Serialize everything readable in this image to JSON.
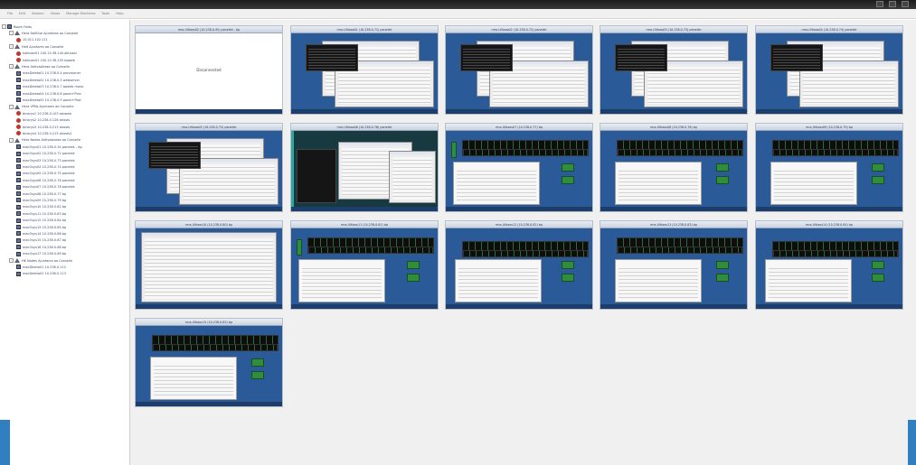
{
  "window": {
    "colors": {
      "titlebar": "#1b1b1b",
      "thumb_bg": "#2b5a99",
      "accent": "#2f7fc1",
      "tree_text": "#3f4c67"
    }
  },
  "menu": {
    "items": [
      "File",
      "Edit",
      "Session",
      "Views",
      "Manage Machines",
      "Tools",
      "Help"
    ]
  },
  "tree": {
    "items": [
      {
        "label": "Room Folds",
        "level": 0,
        "icon": "root-folder-icon",
        "expander": "-"
      },
      {
        "label": "Hera DaiBlue Ajuntams ao Conseile",
        "level": 1,
        "icon": "warning-triangle-icon",
        "expander": "-"
      },
      {
        "label": "10.011.102.111",
        "level": 2,
        "icon": "server-icon",
        "expander": ""
      },
      {
        "label": "Halt Ajuntams ao Conseile",
        "level": 1,
        "icon": "warning-triangle-icon",
        "expander": "-"
      },
      {
        "label": "halbuex01 100.15.38.140.aktivasi",
        "level": 2,
        "icon": "server-icon",
        "expander": ""
      },
      {
        "label": "halbuex01 100.15.38.155 bpweb",
        "level": 2,
        "icon": "server-icon",
        "expander": ""
      },
      {
        "label": "Hera Aktivasibase ao Conseile",
        "level": 1,
        "icon": "warning-triangle-icon",
        "expander": "-"
      },
      {
        "label": "maxDeleta01 10.238.0.4 provisioner",
        "level": 2,
        "icon": "monitor-icon",
        "expander": ""
      },
      {
        "label": "maxDeleta02 10.238.0.5 webserver",
        "level": 2,
        "icon": "monitor-icon",
        "expander": ""
      },
      {
        "label": "maxDeleta03 10.238.0.7 bpweb mono",
        "level": 2,
        "icon": "monitor-icon",
        "expander": ""
      },
      {
        "label": "maxDeleta04 10.238.0.8 panel+Plan",
        "level": 2,
        "icon": "monitor-icon",
        "expander": ""
      },
      {
        "label": "maxDeleta05 10.238.0.9 panel+Post",
        "level": 2,
        "icon": "monitor-icon",
        "expander": ""
      },
      {
        "label": "Hera VPNs Ajuntams ao Conseile",
        "level": 1,
        "icon": "warning-triangle-icon",
        "expander": "-"
      },
      {
        "label": "binarys1 10.238.0.103 ssbweb",
        "level": 2,
        "icon": "server-icon",
        "expander": ""
      },
      {
        "label": "binarys2 10.238.0.126 ahosts",
        "level": 2,
        "icon": "server-icon",
        "expander": ""
      },
      {
        "label": "binarys3 10.238.0.213 ahosts",
        "level": 2,
        "icon": "server-icon",
        "expander": ""
      },
      {
        "label": "binarys4 10.238.0.215 ahosts2",
        "level": 2,
        "icon": "server-icon",
        "expander": ""
      },
      {
        "label": "Hera Nodes Aktivasibase ao Conseile",
        "level": 1,
        "icon": "warning-triangle-icon",
        "expander": "-"
      },
      {
        "label": "macOsys01 10.238.0.34 panelek - Ap",
        "level": 2,
        "icon": "monitor-icon",
        "expander": ""
      },
      {
        "label": "macOsys02 10.238.0.72 panelek",
        "level": 2,
        "icon": "monitor-icon",
        "expander": ""
      },
      {
        "label": "macOsys03 10.238.0.73 panelek",
        "level": 2,
        "icon": "monitor-icon",
        "expander": ""
      },
      {
        "label": "macOsys04 10.238.0.74 panelek",
        "level": 2,
        "icon": "monitor-icon",
        "expander": ""
      },
      {
        "label": "macOsys05 10.238.0.75 panelek",
        "level": 2,
        "icon": "monitor-icon",
        "expander": ""
      },
      {
        "label": "macOsys06 10.238.0.76 panelek",
        "level": 2,
        "icon": "monitor-icon",
        "expander": ""
      },
      {
        "label": "macOsys07 10.238.0.78 panelek",
        "level": 2,
        "icon": "monitor-icon",
        "expander": ""
      },
      {
        "label": "macOsys08 10.238.0.77 bp",
        "level": 2,
        "icon": "monitor-icon",
        "expander": ""
      },
      {
        "label": "macOsys09 10.238.0.79 bp",
        "level": 2,
        "icon": "monitor-icon",
        "expander": ""
      },
      {
        "label": "macOsys10 10.238.0.82 bp",
        "level": 2,
        "icon": "monitor-icon",
        "expander": ""
      },
      {
        "label": "macOsys11 10.238.0.83 bp",
        "level": 2,
        "icon": "monitor-icon",
        "expander": ""
      },
      {
        "label": "macOsys12 10.238.0.84 bp",
        "level": 2,
        "icon": "monitor-icon",
        "expander": ""
      },
      {
        "label": "macOsys13 10.238.0.85 bp",
        "level": 2,
        "icon": "monitor-icon",
        "expander": ""
      },
      {
        "label": "macOsys14 10.238.0.86 bp",
        "level": 2,
        "icon": "monitor-icon",
        "expander": ""
      },
      {
        "label": "macOsys15 10.238.0.87 bp",
        "level": 2,
        "icon": "monitor-icon",
        "expander": ""
      },
      {
        "label": "macOsys16 10.238.0.88 bp",
        "level": 2,
        "icon": "monitor-icon",
        "expander": ""
      },
      {
        "label": "macOsys17 10.238.0.89 bp",
        "level": 2,
        "icon": "monitor-icon",
        "expander": ""
      },
      {
        "label": "HK Nodes Ajuntams ao Conseile",
        "level": 1,
        "icon": "warning-triangle-icon",
        "expander": "-"
      },
      {
        "label": "macDeleta01 10.238.0.112",
        "level": 2,
        "icon": "monitor-icon",
        "expander": ""
      },
      {
        "label": "macDeleta02 10.238.0.113",
        "level": 2,
        "icon": "monitor-icon",
        "expander": ""
      }
    ]
  },
  "gallery": {
    "disconnected_text": "Disconnected",
    "thumbnails": [
      {
        "title": "rma-Ultiaos02 (10.238.0.95) panelek - Ap",
        "kind": "blank"
      },
      {
        "title": "rma-Ultiaos01 (10.238.0.71) panelek",
        "kind": "dark-dialog"
      },
      {
        "title": "rma-Ultiaos02 (10.238.0.72) panelek",
        "kind": "dark-dialog"
      },
      {
        "title": "rma-Ultiaos03 (10.238.0.73) panelek",
        "kind": "dark-dialog"
      },
      {
        "title": "rma-Ultiaos04 (10.238.0.74) panelek",
        "kind": "dark-dialog"
      },
      {
        "title": "rma-Ultiaos05 (10.238.0.75) panelek",
        "kind": "dark-dialog2"
      },
      {
        "title": "rma-Ultiaos06 (10.238.0.76) panelek",
        "kind": "teal"
      },
      {
        "title": "rma-Ultiaos07 (10.238.0.77) bp",
        "kind": "green"
      },
      {
        "title": "rma-Ultiaos08 (10.238.0.78) bp",
        "kind": "green2"
      },
      {
        "title": "rma-Ultiaos09 (10.238.0.79) bp",
        "kind": "green2"
      },
      {
        "title": "rma-Ultiaos10 (10.238.0.80) bp",
        "kind": "white-doc"
      },
      {
        "title": "rma-Ultiaos11 (10.238.0.81) bp",
        "kind": "green"
      },
      {
        "title": "rma-Ultiaos12 (10.238.0.82) bp",
        "kind": "green3"
      },
      {
        "title": "rma-Ultiaos13 (10.238.0.83) bp",
        "kind": "green2"
      },
      {
        "title": "rma-Ultiaos14 (10.238.0.84) bp",
        "kind": "green3"
      },
      {
        "title": "rma-Ultiaos15 (10.238.0.85) bp",
        "kind": "green2"
      }
    ]
  }
}
